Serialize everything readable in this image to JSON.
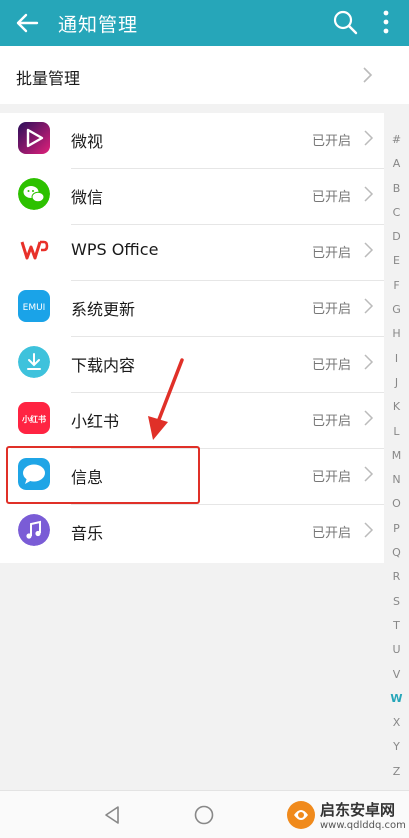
{
  "appbar": {
    "title": "通知管理",
    "icons": [
      "back-arrow-icon",
      "search-icon",
      "more-vertical-icon"
    ],
    "color": "#26a6b9"
  },
  "batch": {
    "label": "批量管理"
  },
  "apps": [
    {
      "name": "微视",
      "status": "已开启",
      "icon": "weishi-app-icon"
    },
    {
      "name": "微信",
      "status": "已开启",
      "icon": "wechat-app-icon"
    },
    {
      "name": "WPS Office",
      "status": "已开启",
      "icon": "wps-office-app-icon"
    },
    {
      "name": "系统更新",
      "status": "已开启",
      "icon": "emui-system-update-icon",
      "icon_text": "EMUI"
    },
    {
      "name": "下载内容",
      "status": "已开启",
      "icon": "download-app-icon"
    },
    {
      "name": "小红书",
      "status": "已开启",
      "icon": "xiaohongshu-app-icon",
      "icon_text": "小红书"
    },
    {
      "name": "信息",
      "status": "已开启",
      "icon": "messages-app-icon"
    },
    {
      "name": "音乐",
      "status": "已开启",
      "icon": "music-app-icon"
    }
  ],
  "index": {
    "letters": [
      "#",
      "A",
      "B",
      "C",
      "D",
      "E",
      "F",
      "G",
      "H",
      "I",
      "J",
      "K",
      "L",
      "M",
      "N",
      "O",
      "P",
      "Q",
      "R",
      "S",
      "T",
      "U",
      "V",
      "W",
      "X",
      "Y",
      "Z"
    ],
    "active": "W"
  },
  "annotation": {
    "highlight_color": "#e03028",
    "highlighted_item": "信息"
  },
  "navbar": {
    "icons": [
      "nav-back-icon",
      "nav-home-icon"
    ]
  },
  "watermark": {
    "title": "启东安卓网",
    "url": "www.qdlddq.com"
  }
}
